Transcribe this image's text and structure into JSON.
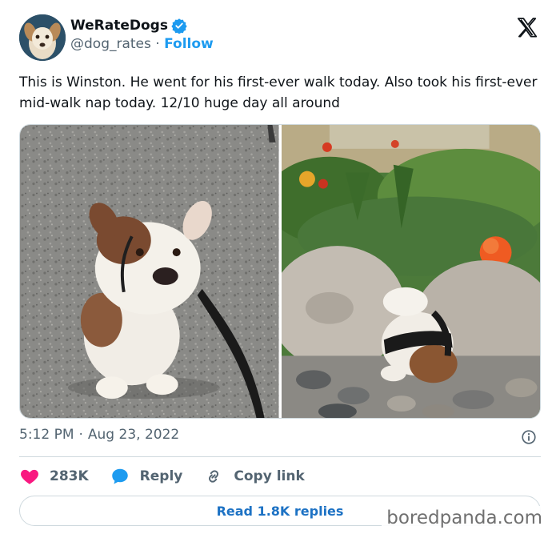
{
  "author": {
    "display_name": "WeRateDogs",
    "handle": "@dog_rates",
    "separator": "·",
    "follow_label": "Follow",
    "verified": true,
    "avatar_icon": "dog-avatar-icon"
  },
  "tweet": {
    "text": "This is Winston. He went for his first-ever walk today. Also took his first-ever mid-walk nap today. 12/10 huge day all around",
    "time": "5:12 PM",
    "dot": "·",
    "date": "Aug 23, 2022"
  },
  "media": {
    "photo_count": 2
  },
  "actions": {
    "likes": "283K",
    "reply_label": "Reply",
    "copy_label": "Copy link"
  },
  "replies_button": {
    "label": "Read 1.8K replies"
  },
  "watermark": {
    "text": "boredpanda.com"
  },
  "colors": {
    "accent": "#1d9bf0",
    "like": "#f91880",
    "muted": "#536471",
    "text": "#0f1419"
  }
}
